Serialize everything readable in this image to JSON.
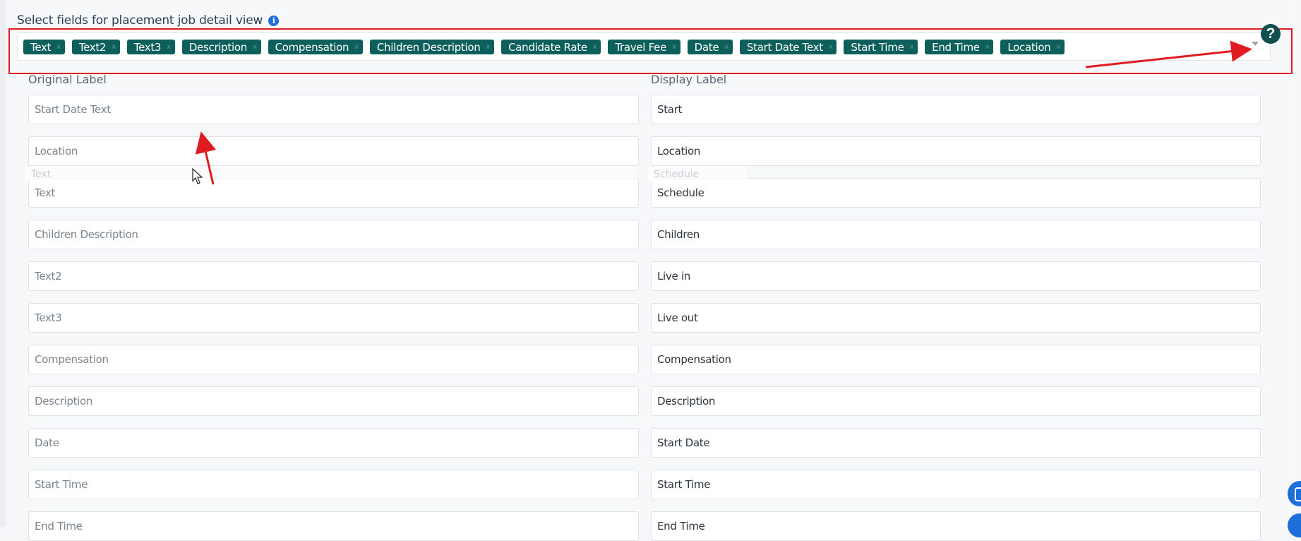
{
  "header": {
    "title": "Select fields for placement job detail view",
    "info_icon": "info-icon"
  },
  "chips": [
    "Text",
    "Text2",
    "Text3",
    "Description",
    "Compensation",
    "Children Description",
    "Candidate Rate",
    "Travel Fee",
    "Date",
    "Start Date Text",
    "Start Time",
    "End Time",
    "Location"
  ],
  "columns": {
    "original": "Original Label",
    "display": "Display Label"
  },
  "drag_ghost": {
    "original": "Text",
    "display": "Schedule"
  },
  "rows": [
    {
      "original": "Start Date Text",
      "display": "Start"
    },
    {
      "original": "Location",
      "display": "Location"
    },
    {
      "original": "Text",
      "display": "Schedule"
    },
    {
      "original": "Children Description",
      "display": "Children"
    },
    {
      "original": "Text2",
      "display": "Live in"
    },
    {
      "original": "Text3",
      "display": "Live out"
    },
    {
      "original": "Compensation",
      "display": "Compensation"
    },
    {
      "original": "Description",
      "display": "Description"
    },
    {
      "original": "Date",
      "display": "Start Date"
    },
    {
      "original": "Start Time",
      "display": "Start Time"
    },
    {
      "original": "End Time",
      "display": "End Time"
    }
  ],
  "icons": {
    "help": "?",
    "chip_remove": "x",
    "dropdown": "chevron-down-icon",
    "chat": "chat-icon"
  },
  "colors": {
    "chip": "#0d5f5c",
    "annotation": "#e01b22",
    "accent": "#1e6fd9"
  }
}
